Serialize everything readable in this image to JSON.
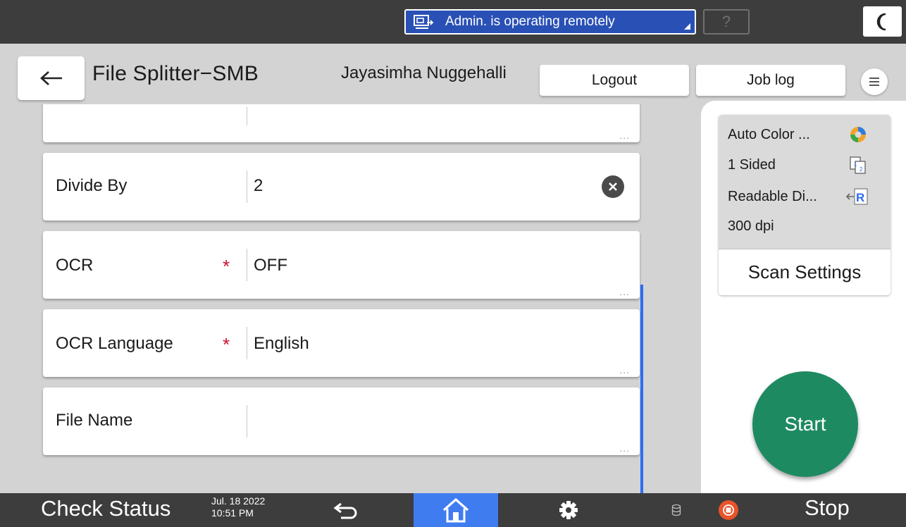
{
  "topbar": {
    "remote_status": "Admin. is operating remotely",
    "help_label": "?",
    "remote_icon": "remote-operation-icon",
    "mode_icon": "moon-icon"
  },
  "header": {
    "back_icon": "arrow-left-icon",
    "title": "File Splitter−SMB",
    "user_name": "Jayasimha Nuggehalli",
    "logout_label": "Logout",
    "joblog_label": "Job log",
    "menu_icon": "hamburger-menu-icon"
  },
  "fields": [
    {
      "label": "",
      "value": "",
      "required": false,
      "more": "...",
      "partial": true
    },
    {
      "label": "Divide By",
      "value": "2",
      "required": false,
      "clear_icon": "clear-x-icon"
    },
    {
      "label": "OCR",
      "value": "OFF",
      "required": true,
      "required_mark": "*",
      "more": "..."
    },
    {
      "label": "OCR Language",
      "value": "English",
      "required": true,
      "required_mark": "*",
      "more": "..."
    },
    {
      "label": "File Name",
      "value": "",
      "required": false,
      "more": "..."
    }
  ],
  "scan_panel": {
    "settings": [
      {
        "text": "Auto Color ...",
        "icon": "auto-color-icon"
      },
      {
        "text": "1 Sided",
        "icon": "one-sided-icon"
      },
      {
        "text": "Readable Di...",
        "icon": "readable-direction-icon"
      },
      {
        "text": "300 dpi",
        "icon": ""
      }
    ],
    "scan_settings_label": "Scan Settings",
    "start_label": "Start"
  },
  "bottombar": {
    "check_status_label": "Check Status",
    "date": "Jul. 18 2022",
    "time": "10:51 PM",
    "back_icon": "return-arrow-icon",
    "home_icon": "home-icon",
    "settings_icon": "gear-icon",
    "storage_icon": "database-icon",
    "stop_icon": "stop-icon",
    "stop_label": "Stop"
  },
  "colors": {
    "remote_pill": "#2950b5",
    "start_button": "#1e8a62",
    "home_button": "#3f7cf0",
    "required_mark": "#c8102e",
    "stop_icon": "#e8532a",
    "scroll_indicator": "#2d6df0"
  }
}
